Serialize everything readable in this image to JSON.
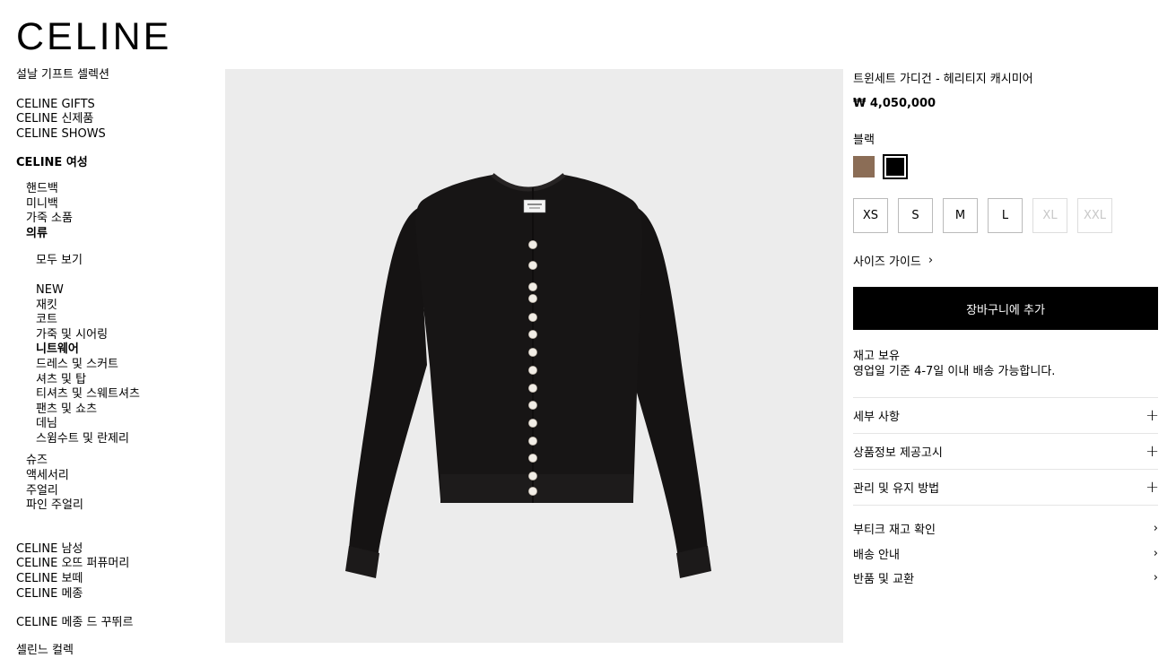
{
  "brand": {
    "logo": "CELINE"
  },
  "nav": {
    "top": "설날 기프트 셀렉션",
    "group1": [
      "CELINE GIFTS",
      "CELINE 신제품",
      "CELINE SHOWS"
    ],
    "women": "CELINE 여성",
    "women_items_a": [
      "핸드백",
      "미니백",
      "가죽 소품"
    ],
    "clothing": "의류",
    "view_all": "모두 보기",
    "clothing_items": [
      "NEW",
      "재킷",
      "코트",
      "가죽 및 시어링",
      "니트웨어",
      "드레스 및 스커트",
      "셔츠 및 탑",
      "티셔츠 및 스웨트셔츠",
      "팬츠 및 쇼츠",
      "데님",
      "스윔수트 및 란제리"
    ],
    "women_items_b": [
      "슈즈",
      "액세서리",
      "주얼리",
      "파인 주얼리"
    ],
    "group2": [
      "CELINE 남성",
      "CELINE 오뜨 퍼퓨머리",
      "CELINE 보떼",
      "CELINE 메종"
    ],
    "maison_boutique": "CELINE 메종 드 꾸뛰르",
    "cut_off": "셀린느 컬렉"
  },
  "product": {
    "title": "트윈세트 가디건 - 헤리티지 캐시미어",
    "price": "₩ 4,050,000",
    "color_name": "블랙",
    "colors": [
      {
        "name": "brown",
        "hex": "#8b6d56"
      },
      {
        "name": "black",
        "hex": "#000000",
        "selected": true
      }
    ],
    "sizes": [
      {
        "label": "XS",
        "available": true
      },
      {
        "label": "S",
        "available": true
      },
      {
        "label": "M",
        "available": true
      },
      {
        "label": "L",
        "available": true
      },
      {
        "label": "XL",
        "available": false
      },
      {
        "label": "XXL",
        "available": false
      }
    ],
    "size_guide": "사이즈 가이드",
    "add_to_cart": "장바구니에 추가",
    "stock_status": "재고 보유",
    "delivery_note": "영업일 기준 4-7일 이내 배송 가능합니다.",
    "accordions": [
      "세부 사항",
      "상품정보 제공고시",
      "관리 및 유지 방법"
    ],
    "links": [
      "부티크 재고 확인",
      "배송 안내",
      "반품 및 교환"
    ]
  },
  "icons": {
    "plus": "+",
    "chevron": "›"
  },
  "colors": {
    "hero_bg": "#ececec",
    "button_bg": "#000000",
    "garment": "#161414"
  }
}
